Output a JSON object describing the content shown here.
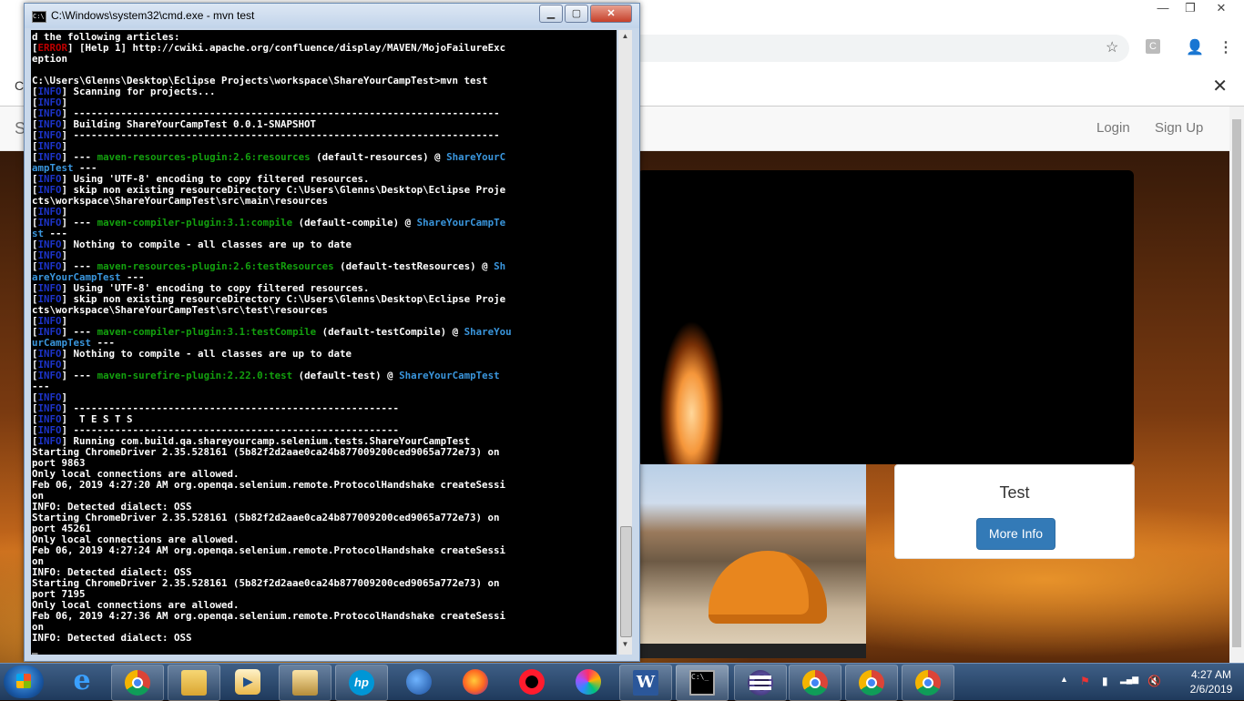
{
  "browser": {
    "window_controls": {
      "minimize": "—",
      "maximize": "❐",
      "close": "✕"
    },
    "addressbar": {
      "star_icon": "☆",
      "extension_badge": "C",
      "profile_icon": "👤",
      "menu_icon": "⋮"
    },
    "infobar": {
      "leading_char": "C",
      "close_icon": "✕"
    },
    "site": {
      "brand": "S",
      "nav": {
        "login": "Login",
        "signup": "Sign Up"
      },
      "card": {
        "title": "Test",
        "button": "More Info"
      }
    }
  },
  "cmd": {
    "title": "C:\\Windows\\system32\\cmd.exe - mvn  test",
    "icon_text": "C:\\",
    "buttons": {
      "minimize": "▁",
      "maximize": "▢",
      "close": "✕"
    },
    "lines": [
      {
        "t": "plain",
        "text": "d the following articles:",
        "bold": true
      },
      {
        "t": "err",
        "text": " [Help 1] http://cwiki.apache.org/confluence/display/MAVEN/MojoFailureExc"
      },
      {
        "t": "plain",
        "text": "eption",
        "bold": true
      },
      {
        "t": "plain",
        "text": ""
      },
      {
        "t": "plain",
        "text": "C:\\Users\\Glenns\\Desktop\\Eclipse Projects\\workspace\\ShareYourCampTest>mvn test",
        "bold": true
      },
      {
        "t": "info",
        "text": " Scanning for projects..."
      },
      {
        "t": "info",
        "text": ""
      },
      {
        "t": "info",
        "text": " ------------------------------------------------------------------------"
      },
      {
        "t": "info",
        "text": " Building ShareYourCampTest 0.0.1-SNAPSHOT"
      },
      {
        "t": "info",
        "text": " ------------------------------------------------------------------------"
      },
      {
        "t": "info",
        "text": ""
      },
      {
        "t": "info",
        "pre": " --- ",
        "green": "maven-resources-plugin:2.6:resources",
        "mid": " (default-resources) @ ",
        "teal": "ShareYourC"
      },
      {
        "t": "teal",
        "text": "ampTest",
        "post": " ---"
      },
      {
        "t": "info",
        "text": " Using 'UTF-8' encoding to copy filtered resources."
      },
      {
        "t": "info",
        "text": " skip non existing resourceDirectory C:\\Users\\Glenns\\Desktop\\Eclipse Proje"
      },
      {
        "t": "plain",
        "text": "cts\\workspace\\ShareYourCampTest\\src\\main\\resources"
      },
      {
        "t": "info",
        "text": ""
      },
      {
        "t": "info",
        "pre": " --- ",
        "green": "maven-compiler-plugin:3.1:compile",
        "mid": " (default-compile) @ ",
        "teal": "ShareYourCampTe"
      },
      {
        "t": "teal",
        "text": "st",
        "post": " ---"
      },
      {
        "t": "info",
        "text": " Nothing to compile - all classes are up to date"
      },
      {
        "t": "info",
        "text": ""
      },
      {
        "t": "info",
        "pre": " --- ",
        "green": "maven-resources-plugin:2.6:testResources",
        "mid": " (default-testResources) @ ",
        "teal": "Sh"
      },
      {
        "t": "teal",
        "text": "areYourCampTest",
        "post": " ---"
      },
      {
        "t": "info",
        "text": " Using 'UTF-8' encoding to copy filtered resources."
      },
      {
        "t": "info",
        "text": " skip non existing resourceDirectory C:\\Users\\Glenns\\Desktop\\Eclipse Proje"
      },
      {
        "t": "plain",
        "text": "cts\\workspace\\ShareYourCampTest\\src\\test\\resources"
      },
      {
        "t": "info",
        "text": ""
      },
      {
        "t": "info",
        "pre": " --- ",
        "green": "maven-compiler-plugin:3.1:testCompile",
        "mid": " (default-testCompile) @ ",
        "teal": "ShareYou"
      },
      {
        "t": "teal",
        "text": "urCampTest",
        "post": " ---"
      },
      {
        "t": "info",
        "text": " Nothing to compile - all classes are up to date"
      },
      {
        "t": "info",
        "text": ""
      },
      {
        "t": "info",
        "pre": " --- ",
        "green": "maven-surefire-plugin:2.22.0:test",
        "mid": " (default-test) @ ",
        "teal": "ShareYourCampTest"
      },
      {
        "t": "plain",
        "text": "---"
      },
      {
        "t": "info",
        "text": ""
      },
      {
        "t": "info",
        "text": " -------------------------------------------------------"
      },
      {
        "t": "info",
        "text": "  T E S T S"
      },
      {
        "t": "info",
        "text": " -------------------------------------------------------"
      },
      {
        "t": "info",
        "text": " Running com.build.qa.shareyourcamp.selenium.tests.ShareYourCampTest"
      },
      {
        "t": "plain",
        "text": "Starting ChromeDriver 2.35.528161 (5b82f2d2aae0ca24b877009200ced9065a772e73) on",
        "bold": true
      },
      {
        "t": "plain",
        "text": "port 9863",
        "bold": true
      },
      {
        "t": "plain",
        "text": "Only local connections are allowed.",
        "bold": true
      },
      {
        "t": "plain",
        "text": "Feb 06, 2019 4:27:20 AM org.openqa.selenium.remote.ProtocolHandshake createSessi",
        "bold": true
      },
      {
        "t": "plain",
        "text": "on",
        "bold": true
      },
      {
        "t": "plain",
        "text": "INFO: Detected dialect: OSS",
        "bold": true
      },
      {
        "t": "plain",
        "text": "Starting ChromeDriver 2.35.528161 (5b82f2d2aae0ca24b877009200ced9065a772e73) on",
        "bold": true
      },
      {
        "t": "plain",
        "text": "port 45261",
        "bold": true
      },
      {
        "t": "plain",
        "text": "Only local connections are allowed.",
        "bold": true
      },
      {
        "t": "plain",
        "text": "Feb 06, 2019 4:27:24 AM org.openqa.selenium.remote.ProtocolHandshake createSessi",
        "bold": true
      },
      {
        "t": "plain",
        "text": "on",
        "bold": true
      },
      {
        "t": "plain",
        "text": "INFO: Detected dialect: OSS",
        "bold": true
      },
      {
        "t": "plain",
        "text": "Starting ChromeDriver 2.35.528161 (5b82f2d2aae0ca24b877009200ced9065a772e73) on",
        "bold": true
      },
      {
        "t": "plain",
        "text": "port 7195",
        "bold": true
      },
      {
        "t": "plain",
        "text": "Only local connections are allowed.",
        "bold": true
      },
      {
        "t": "plain",
        "text": "Feb 06, 2019 4:27:36 AM org.openqa.selenium.remote.ProtocolHandshake createSessi",
        "bold": true
      },
      {
        "t": "plain",
        "text": "on",
        "bold": true
      },
      {
        "t": "plain",
        "text": "INFO: Detected dialect: OSS",
        "bold": true
      },
      {
        "t": "plain",
        "text": "_"
      }
    ],
    "tags": {
      "info": "INFO",
      "error": "ERROR"
    }
  },
  "taskbar": {
    "hp_label": "hp",
    "word_label": "W",
    "cmd_icon_text": "C:\\_",
    "ie_label": "e",
    "tray": {
      "chevron": "▲",
      "flag": "⚑",
      "battery": "▮",
      "signal": "▂▄▆",
      "volume": "🔇"
    },
    "clock": {
      "time": "4:27 AM",
      "date": "2/6/2019"
    }
  },
  "colors": {
    "accent_button": "#337ab7",
    "console_bg": "#000000",
    "maven_plugin": "#13a10e",
    "maven_project": "#3a96dd",
    "info_tag": "#1c33c8",
    "error_tag": "#c00000"
  }
}
